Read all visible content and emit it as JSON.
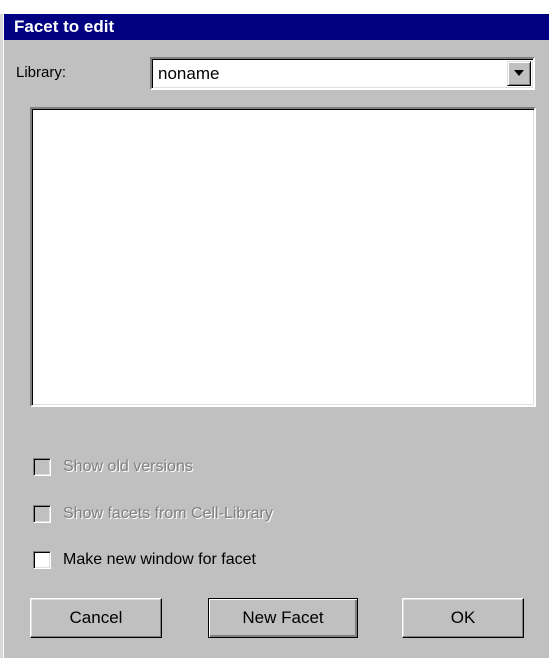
{
  "dialog": {
    "title": "Facet to edit"
  },
  "library": {
    "label": "Library:",
    "selected": "noname"
  },
  "facet_list": {
    "items": []
  },
  "options": {
    "show_old_versions": {
      "label": "Show old versions",
      "checked": false,
      "enabled": false
    },
    "show_cell_library": {
      "label": "Show facets from Cell-Library",
      "checked": false,
      "enabled": false
    },
    "new_window": {
      "label": "Make new window for facet",
      "checked": false,
      "enabled": true
    }
  },
  "buttons": {
    "cancel": "Cancel",
    "new_facet": "New Facet",
    "ok": "OK"
  },
  "icons": {
    "dropdown": "chevron-down-icon"
  }
}
